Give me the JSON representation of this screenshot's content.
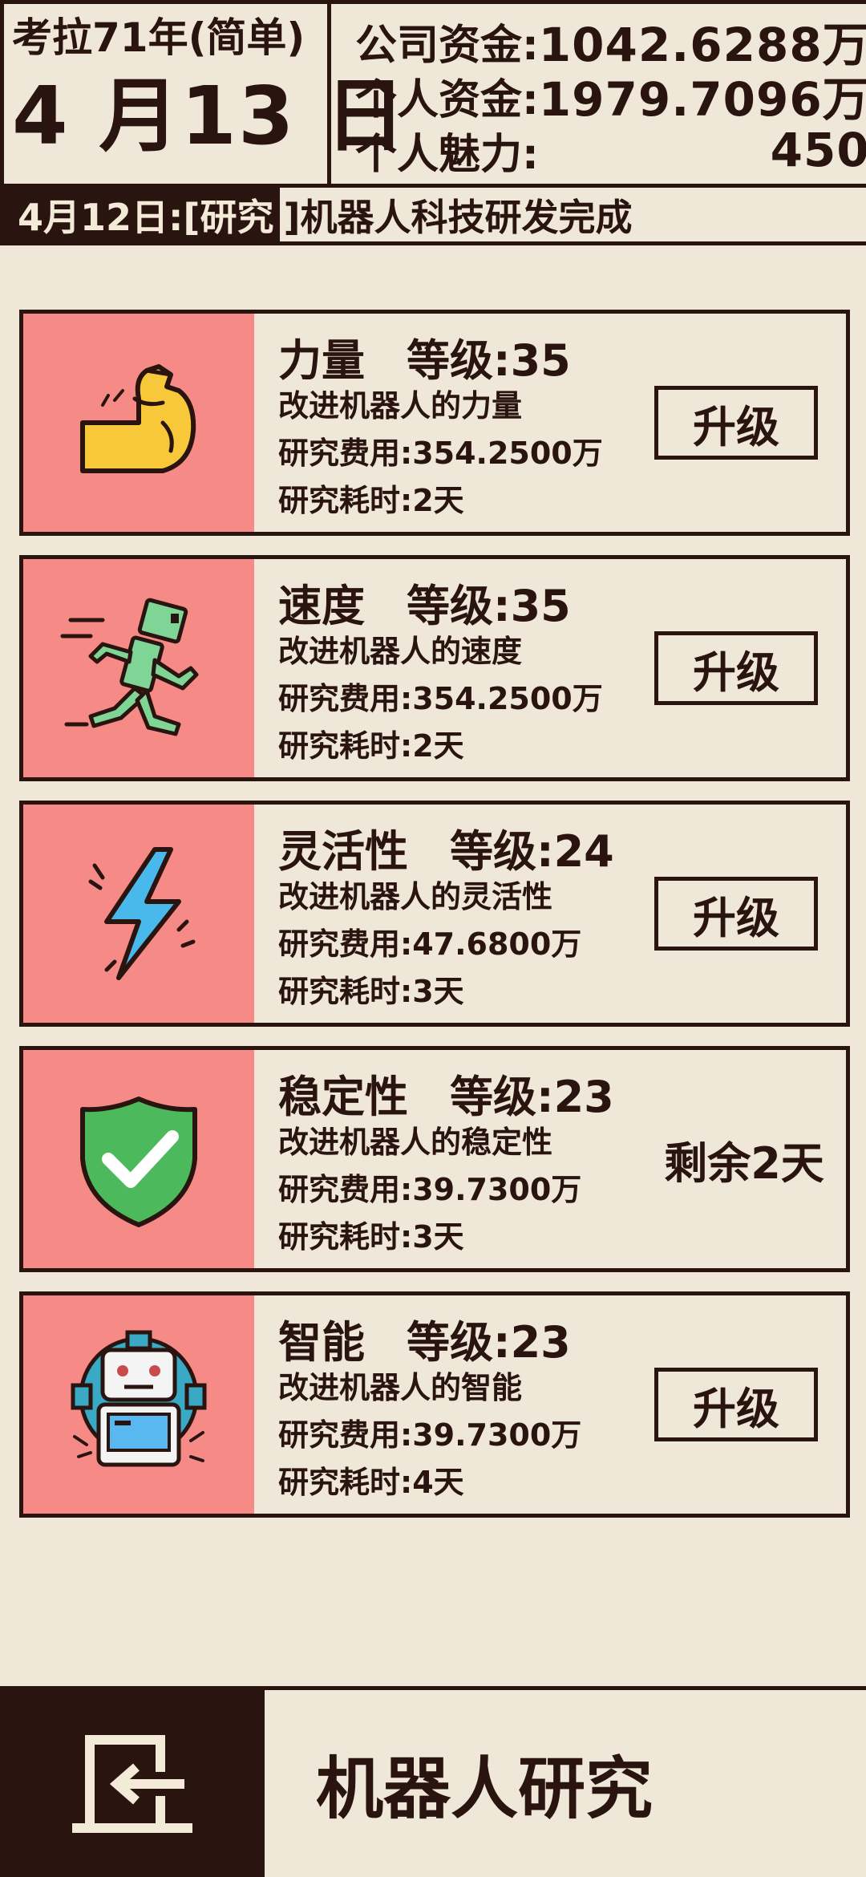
{
  "header": {
    "scenario": "考拉71年(简单)",
    "date": "4 月13 日",
    "stats": [
      {
        "label": "公司资金:",
        "value": "1042.6288万"
      },
      {
        "label": "个人资金:",
        "value": "1979.7096万"
      },
      {
        "label": "个人魅力:",
        "value": "450"
      }
    ]
  },
  "news": {
    "prefix": "4月12日:[研究",
    "text": "]机器人科技研发完成"
  },
  "level_label": "等级:",
  "cards": [
    {
      "name": "力量",
      "level": "35",
      "desc": "改进机器人的力量",
      "cost": "研究费用:354.2500万",
      "time": "研究耗时:2天",
      "action": "升级",
      "icon": "flexed-arm-icon"
    },
    {
      "name": "速度",
      "level": "35",
      "desc": "改进机器人的速度",
      "cost": "研究费用:354.2500万",
      "time": "研究耗时:2天",
      "action": "升级",
      "icon": "running-robot-icon"
    },
    {
      "name": "灵活性",
      "level": "24",
      "desc": "改进机器人的灵活性",
      "cost": "研究费用:47.6800万",
      "time": "研究耗时:3天",
      "action": "升级",
      "icon": "lightning-bolt-icon"
    },
    {
      "name": "稳定性",
      "level": "23",
      "desc": "改进机器人的稳定性",
      "cost": "研究费用:39.7300万",
      "time": "研究耗时:3天",
      "remaining": "剩余2天",
      "icon": "shield-check-icon"
    },
    {
      "name": "智能",
      "level": "23",
      "desc": "改进机器人的智能",
      "cost": "研究费用:39.7300万",
      "time": "研究耗时:4天",
      "action": "升级",
      "icon": "robot-gear-icon"
    }
  ],
  "footer": {
    "title": "机器人研究",
    "exit_icon": "exit-door-icon"
  },
  "colors": {
    "background": "#efe7d8",
    "ink": "#2a1410",
    "card_icon_bg": "#f68a86"
  }
}
